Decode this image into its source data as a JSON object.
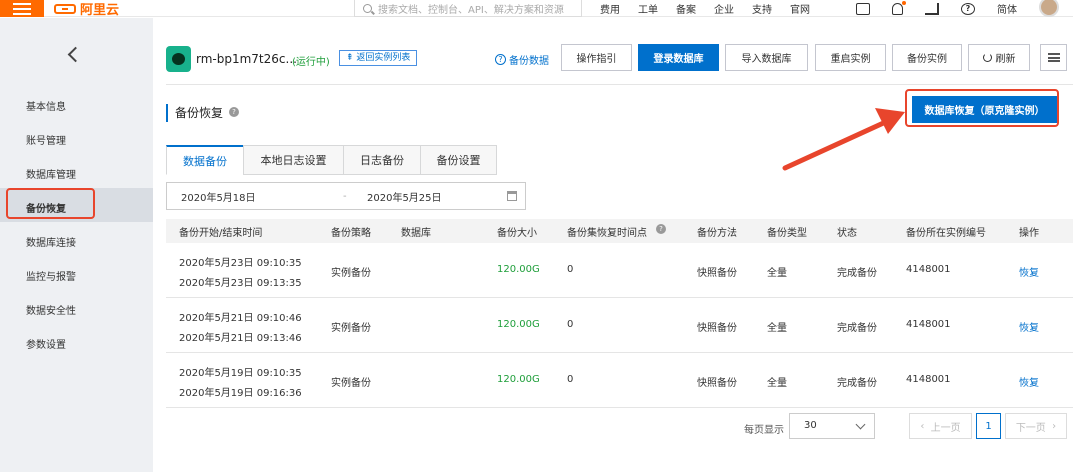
{
  "topbar": {
    "logo_text": "阿里云",
    "search_placeholder": "搜索文档、控制台、API、解决方案和资源",
    "links": [
      "费用",
      "工单",
      "备案",
      "企业",
      "支持",
      "官网"
    ],
    "lang": "简体"
  },
  "sidebar": {
    "items": [
      "基本信息",
      "账号管理",
      "数据库管理",
      "备份恢复",
      "数据库连接",
      "监控与报警",
      "数据安全性",
      "参数设置"
    ]
  },
  "instance": {
    "name": "rm-bp1m7t26c...",
    "status": "(运行中)",
    "back_list": "返回实例列表"
  },
  "toolbar": {
    "help": "备份数据",
    "guide": "操作指引",
    "login_db": "登录数据库",
    "import_db": "导入数据库",
    "restart": "重启实例",
    "backup": "备份实例",
    "refresh": "刷新"
  },
  "section": {
    "title": "备份恢复",
    "restore_button": "数据库恢复（原克隆实例）"
  },
  "tabs": [
    "数据备份",
    "本地日志设置",
    "日志备份",
    "备份设置"
  ],
  "daterange": {
    "start": "2020年5月18日",
    "sep": "-",
    "end": "2020年5月25日"
  },
  "table": {
    "headers": [
      "备份开始/结束时间",
      "备份策略",
      "数据库",
      "备份大小",
      "备份集恢复时间点",
      "备份方法",
      "备份类型",
      "状态",
      "备份所在实例编号",
      "操作"
    ],
    "rows": [
      {
        "start": "2020年5月23日 09:10:35",
        "end": "2020年5月23日 09:13:35",
        "policy": "实例备份",
        "db": "",
        "size": "120.00G",
        "point": "0",
        "method": "快照备份",
        "type": "全量",
        "status": "完成备份",
        "inst": "4148001",
        "action": "恢复"
      },
      {
        "start": "2020年5月21日 09:10:46",
        "end": "2020年5月21日 09:13:46",
        "policy": "实例备份",
        "db": "",
        "size": "120.00G",
        "point": "0",
        "method": "快照备份",
        "type": "全量",
        "status": "完成备份",
        "inst": "4148001",
        "action": "恢复"
      },
      {
        "start": "2020年5月19日 09:10:35",
        "end": "2020年5月19日 09:16:36",
        "policy": "实例备份",
        "db": "",
        "size": "120.00G",
        "point": "0",
        "method": "快照备份",
        "type": "全量",
        "status": "完成备份",
        "inst": "4148001",
        "action": "恢复"
      }
    ]
  },
  "pagination": {
    "per_page_label": "每页显示",
    "per_page": "30",
    "prev": "上一页",
    "current": "1",
    "next": "下一页"
  },
  "colors": {
    "brand": "#ff6a00",
    "primary": "#0070cc",
    "highlight": "#e8452c",
    "success": "#1e9e3a"
  }
}
